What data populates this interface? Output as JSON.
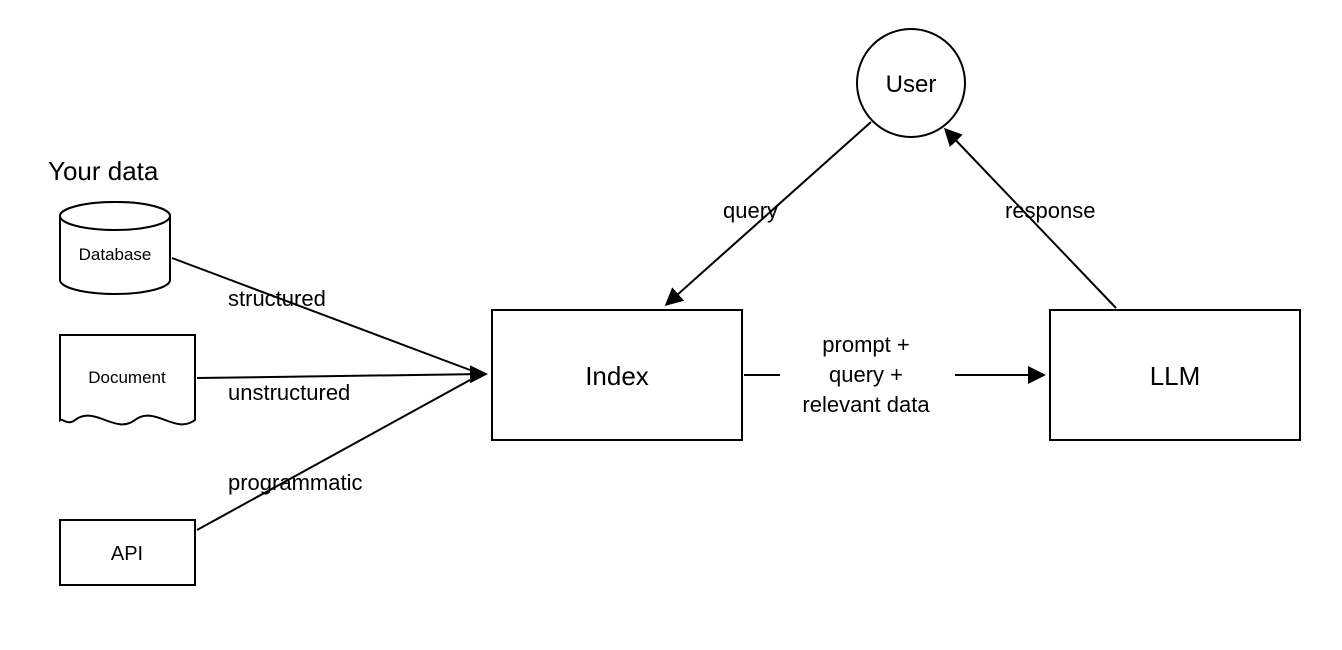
{
  "title": "Your data",
  "nodes": {
    "database": "Database",
    "document": "Document",
    "api": "API",
    "index": "Index",
    "llm": "LLM",
    "user": "User"
  },
  "edges": {
    "structured": "structured",
    "unstructured": "unstructured",
    "programmatic": "programmatic",
    "query": "query",
    "response": "response",
    "prompt_line1": "prompt +",
    "prompt_line2": "query +",
    "prompt_line3": "relevant data"
  }
}
